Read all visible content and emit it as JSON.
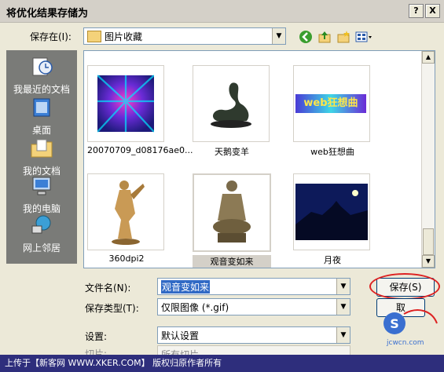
{
  "window": {
    "title": "将优化结果存储为",
    "help": "?",
    "close": "X"
  },
  "location": {
    "label": "保存在(I):",
    "value": "图片收藏"
  },
  "places": [
    {
      "label": "我最近的文档",
      "icon": "recent-docs-icon"
    },
    {
      "label": "桌面",
      "icon": "desktop-icon"
    },
    {
      "label": "我的文档",
      "icon": "my-documents-icon"
    },
    {
      "label": "我的电脑",
      "icon": "my-computer-icon"
    },
    {
      "label": "网上邻居",
      "icon": "network-places-icon"
    }
  ],
  "files": [
    {
      "name": "20070709_d08176ae0..."
    },
    {
      "name": "天鹅变羊"
    },
    {
      "name": "web狂想曲",
      "thumb_text": "web狂想曲"
    },
    {
      "name": "360dpi2"
    },
    {
      "name": "观音变如来"
    },
    {
      "name": "月夜"
    }
  ],
  "form": {
    "filename_label": "文件名(N):",
    "filename_value": "观音变如来",
    "type_label": "保存类型(T):",
    "type_value": "仅限图像 (*.gif)",
    "settings_label": "设置:",
    "settings_value": "默认设置",
    "slices_label": "切片:",
    "slices_value": "所有切片"
  },
  "buttons": {
    "save": "保存(S)",
    "cancel": "取"
  },
  "footer": {
    "text": "上传于【新客网 WWW.XKER.COM】 版权归原作者所有"
  },
  "watermark": {
    "text": "jcwcn.com"
  }
}
